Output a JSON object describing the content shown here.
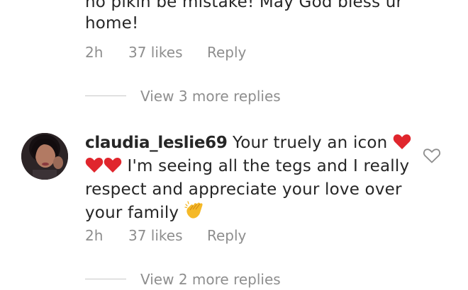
{
  "comments": [
    {
      "text_line1": "no pikin be mistake! May God bless ur",
      "text_line2": "home!",
      "time": "2h",
      "likes": "37 likes",
      "reply": "Reply",
      "view_more": "View 3 more replies"
    },
    {
      "username": "claudia_leslie69",
      "text_part1": "Your truely an icon",
      "text_part2": "I'm seeing all the tegs and I really",
      "text_line3": "respect and appreciate your love over",
      "text_line4": "your family",
      "emojis": [
        "red-heart",
        "red-heart",
        "red-heart",
        "clapping-hands"
      ],
      "time": "2h",
      "likes": "37 likes",
      "reply": "Reply",
      "view_more": "View 2 more replies"
    }
  ],
  "colors": {
    "text": "#262626",
    "meta": "#8e8e8e",
    "divider": "#c7c7c7",
    "heart": "#e0262d"
  },
  "icons": {
    "like": "heart-outline-icon"
  }
}
